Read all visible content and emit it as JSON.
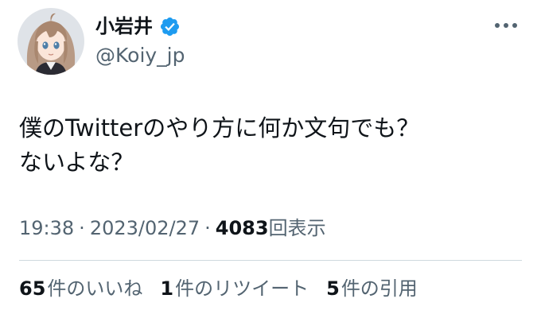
{
  "user": {
    "display_name": "小岩井",
    "handle": "@Koiy_jp",
    "verified": true
  },
  "tweet": {
    "lines": [
      "僕のTwitterのやり方に何か文句でも？",
      "ないよな？"
    ]
  },
  "meta": {
    "time": "19:38",
    "separator": "·",
    "date": "2023/02/27",
    "views_count": "4083",
    "views_label": "回表示"
  },
  "stats": {
    "likes_count": "65",
    "likes_label": "件のいいね",
    "retweets_count": "1",
    "retweets_label": "件のリツイート",
    "quotes_count": "5",
    "quotes_label": "件の引用"
  },
  "icons": {
    "verified": "verified-badge-icon",
    "more": "more-options-icon"
  },
  "colors": {
    "verified_blue": "#1d9bf0",
    "secondary_text": "#536471",
    "primary_text": "#0f1419",
    "divider": "#cfd9de"
  }
}
